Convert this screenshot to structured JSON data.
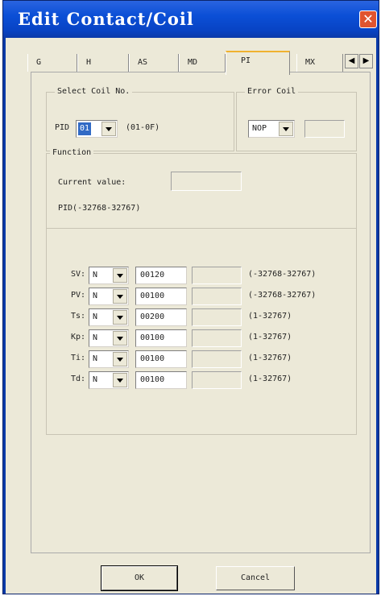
{
  "window": {
    "title": "Edit Contact/Coil",
    "close_glyph": "✕"
  },
  "tabs": [
    {
      "label": "G"
    },
    {
      "label": "H"
    },
    {
      "label": "AS"
    },
    {
      "label": "MD"
    },
    {
      "label": "PI",
      "active": true
    },
    {
      "label": "MX"
    }
  ],
  "tab_scroll": {
    "left": "◀",
    "right": "▶"
  },
  "select_coil": {
    "group_label": "Select Coil No.",
    "prefix": "PID",
    "value": "01",
    "range": "(01-0F)"
  },
  "error_coil": {
    "group_label": "Error Coil",
    "value": "NOP",
    "extra_value": ""
  },
  "function": {
    "group_label": "Function",
    "current_value_label": "Current value:",
    "current_value": "",
    "range_text": "PID(-32768-32767)"
  },
  "params": [
    {
      "label": "SV:",
      "type": "N",
      "value": "00120",
      "extra": "",
      "range": "(-32768-32767)"
    },
    {
      "label": "PV:",
      "type": "N",
      "value": "00100",
      "extra": "",
      "range": "(-32768-32767)"
    },
    {
      "label": "Ts:",
      "type": "N",
      "value": "00200",
      "extra": "",
      "range": "(1-32767)"
    },
    {
      "label": "Kp:",
      "type": "N",
      "value": "00100",
      "extra": "",
      "range": "(1-32767)"
    },
    {
      "label": "Ti:",
      "type": "N",
      "value": "00100",
      "extra": "",
      "range": "(1-32767)"
    },
    {
      "label": "Td:",
      "type": "N",
      "value": "00100",
      "extra": "",
      "range": "(1-32767)"
    }
  ],
  "buttons": {
    "ok": "OK",
    "cancel": "Cancel"
  }
}
